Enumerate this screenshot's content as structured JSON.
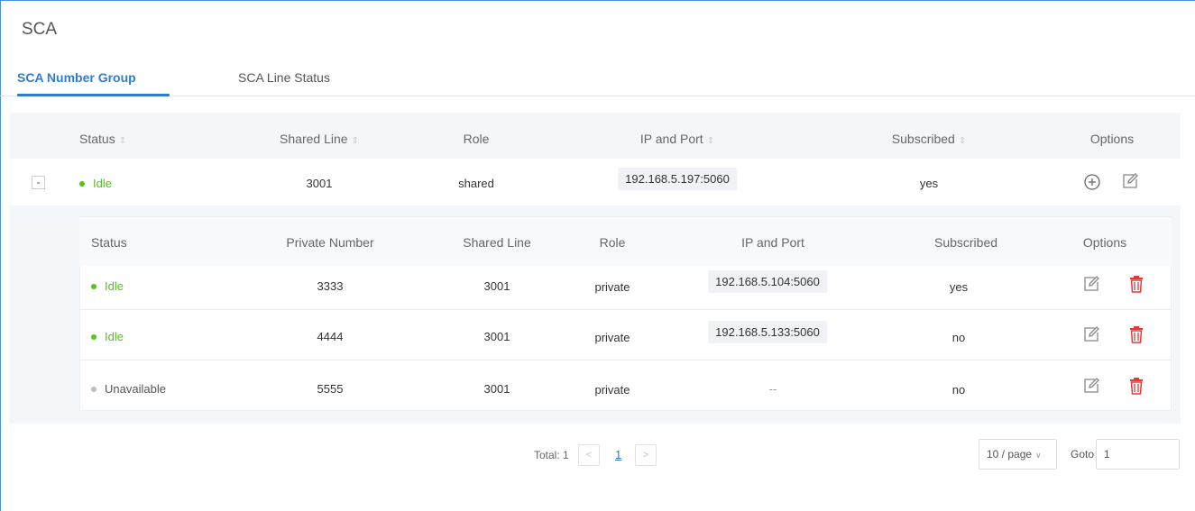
{
  "page": {
    "title": "SCA"
  },
  "tabs": [
    {
      "label": "SCA Number Group",
      "active": true
    },
    {
      "label": "SCA Line Status",
      "active": false
    }
  ],
  "group_table": {
    "headers": {
      "status": "Status",
      "shared_line": "Shared Line",
      "role": "Role",
      "ip_port": "IP and Port",
      "subscribed": "Subscribed",
      "options": "Options"
    },
    "sort_glyph": "⇕",
    "row": {
      "collapse": "-",
      "status": "Idle",
      "shared_line": "3001",
      "role": "shared",
      "ip_port": "192.168.5.197:5060",
      "subscribed": "yes"
    }
  },
  "sub_table": {
    "headers": {
      "status": "Status",
      "private_number": "Private Number",
      "shared_line": "Shared Line",
      "role": "Role",
      "ip_port": "IP and Port",
      "subscribed": "Subscribed",
      "options": "Options"
    },
    "rows": [
      {
        "status": "Idle",
        "private_number": "3333",
        "shared_line": "3001",
        "role": "private",
        "ip_port": "192.168.5.104:5060",
        "subscribed": "yes"
      },
      {
        "status": "Idle",
        "private_number": "4444",
        "shared_line": "3001",
        "role": "private",
        "ip_port": "192.168.5.133:5060",
        "subscribed": "no"
      },
      {
        "status": "Unavailable",
        "private_number": "5555",
        "shared_line": "3001",
        "role": "private",
        "ip_port": "--",
        "subscribed": "no"
      }
    ]
  },
  "pagination": {
    "total": "Total: 1",
    "prev": "<",
    "page": "1",
    "next": ">",
    "page_size": "10 / page",
    "goto_label": "Goto",
    "goto_value": "1"
  },
  "colors": {
    "accent": "#2f7dd1",
    "idle": "#52c41a",
    "unavailable": "#bfbfbf",
    "delete": "#e53935"
  }
}
